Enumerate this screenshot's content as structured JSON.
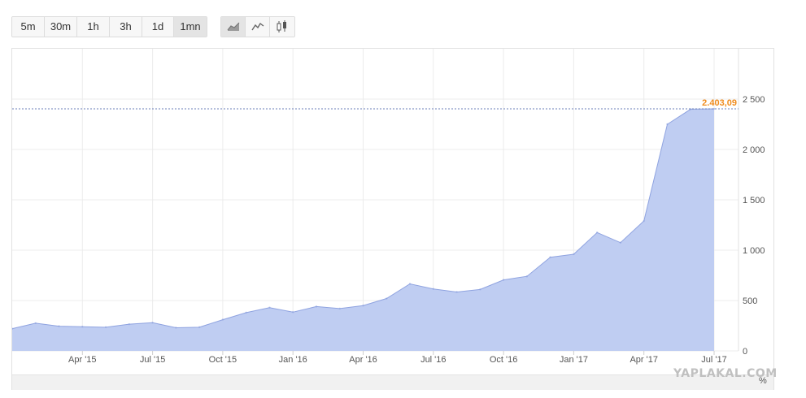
{
  "toolbar": {
    "ranges": [
      "5m",
      "30m",
      "1h",
      "3h",
      "1d",
      "1mn"
    ],
    "active_range": "1mn",
    "chart_types": [
      {
        "icon": "area-chart-icon",
        "active": true
      },
      {
        "icon": "line-chart-icon",
        "active": false
      },
      {
        "icon": "candlestick-icon",
        "active": false
      }
    ]
  },
  "colors": {
    "area_fill": "#bfcdf2",
    "area_line": "#8fa3e0",
    "last_value": "#f08c1e",
    "reference_line": "#6b7fb8",
    "grid": "#ececec",
    "axis_text": "#555555"
  },
  "chart_data": {
    "type": "area",
    "x_ticks": [
      "Apr '15",
      "Jul '15",
      "Oct '15",
      "Jan '16",
      "Apr '16",
      "Jul '16",
      "Oct '16",
      "Jan '17",
      "Apr '17",
      "Jul '17"
    ],
    "y_ticks": [
      "0",
      "500",
      "1 000",
      "1 500",
      "2 000",
      "2 500"
    ],
    "y_tick_values": [
      0,
      500,
      1000,
      1500,
      2000,
      2500
    ],
    "ylim": [
      0,
      2500
    ],
    "y_axis_side": "right",
    "x": [
      "2015-01",
      "2015-02",
      "2015-03",
      "2015-04",
      "2015-05",
      "2015-06",
      "2015-07",
      "2015-08",
      "2015-09",
      "2015-10",
      "2015-11",
      "2015-12",
      "2016-01",
      "2016-02",
      "2016-03",
      "2016-04",
      "2016-05",
      "2016-06",
      "2016-07",
      "2016-08",
      "2016-09",
      "2016-10",
      "2016-11",
      "2016-12",
      "2017-01",
      "2017-02",
      "2017-03",
      "2017-04",
      "2017-05",
      "2017-06",
      "2017-07"
    ],
    "values": [
      220,
      275,
      245,
      240,
      235,
      265,
      280,
      230,
      235,
      310,
      380,
      430,
      385,
      440,
      420,
      450,
      520,
      665,
      615,
      585,
      610,
      705,
      740,
      930,
      960,
      1175,
      1075,
      1290,
      2250,
      2400,
      2403.09
    ],
    "last_value_label": "2.403,09",
    "grid": true,
    "unit_label": "%"
  },
  "watermark": "YAPLAKAL.COM"
}
